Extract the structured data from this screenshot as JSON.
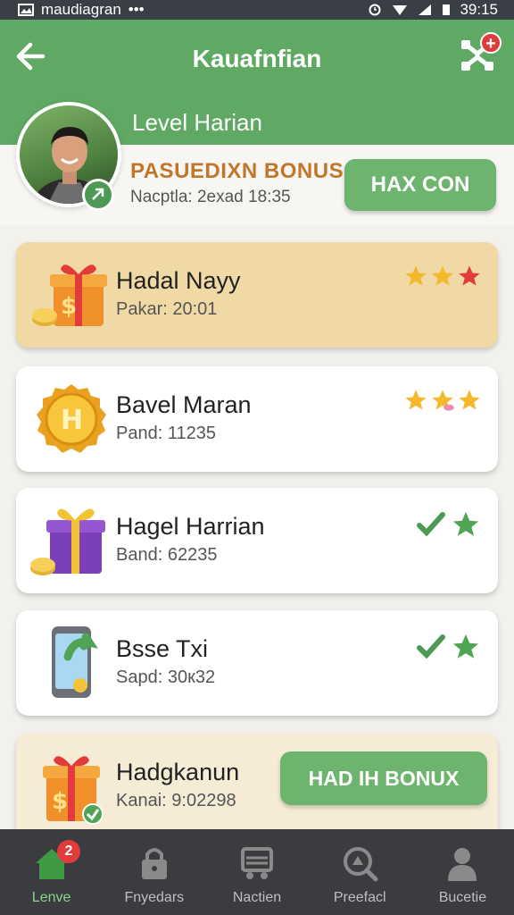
{
  "status_bar": {
    "app_label": "maudiagran",
    "dots": "•••",
    "time": "39:15"
  },
  "header": {
    "title": "Kauafnfian"
  },
  "profile": {
    "level_label": "Level Harian",
    "bonus_title": "PASUEDIXN BONUS",
    "bonus_subtitle": "Nacptla: 2exad 18:35",
    "button_label": "HAX CON"
  },
  "rewards": [
    {
      "title": "Hadal Nayy",
      "subtitle": "Pakar: 20:01",
      "icon": "gift-box-coin-icon",
      "stars": [
        "gold",
        "gold",
        "red"
      ],
      "highlighted": true
    },
    {
      "title": "Bavel Maran",
      "subtitle": "Pand: 11235",
      "icon": "gold-coin-icon",
      "stars": [
        "gold",
        "gold-broken",
        "gold"
      ],
      "highlighted": false
    },
    {
      "title": "Hagel Harrian",
      "subtitle": "Band: 62235",
      "icon": "purple-gift-icon",
      "status": [
        "check-icon",
        "green-star-icon"
      ],
      "highlighted": false
    },
    {
      "title": "Bsse Txi",
      "subtitle": "Sapd: 30к32",
      "icon": "phone-refresh-icon",
      "status": [
        "check-icon",
        "green-star-icon"
      ],
      "highlighted": false
    },
    {
      "title": "Hadgkanun",
      "subtitle": "Kanai: 9:02298",
      "icon": "gift-box-check-icon",
      "button_label": "HAD IH BONUX",
      "highlighted": true
    }
  ],
  "bottom_nav": [
    {
      "label": "Lenve",
      "icon": "home-icon",
      "badge": "2",
      "active": true
    },
    {
      "label": "Fnyedars",
      "icon": "lock-icon",
      "active": false
    },
    {
      "label": "Nactien",
      "icon": "cart-icon",
      "active": false
    },
    {
      "label": "Preefacl",
      "icon": "search-icon",
      "active": false
    },
    {
      "label": "Bucetie",
      "icon": "profile-icon",
      "active": false
    }
  ],
  "colors": {
    "primary_green": "#5fa964",
    "button_green": "#6db56f",
    "gold_card": "#f1d9a6",
    "nav_bg": "#3a3c40",
    "badge_red": "#e23b3b",
    "bonus_orange": "#c0772a"
  }
}
